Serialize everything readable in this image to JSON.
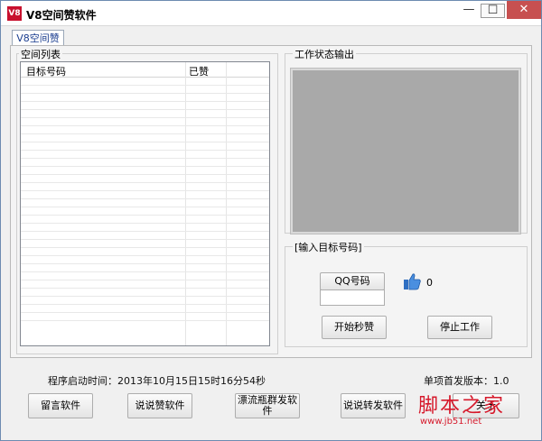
{
  "window": {
    "title": "V8空间赞软件",
    "icon_text": "V8"
  },
  "titlebar": {
    "minimize": "—",
    "maximize": "☐",
    "close": "✕"
  },
  "tab": {
    "label": "V8空间赞"
  },
  "space_list": {
    "group_label": "空间列表",
    "columns": [
      "目标号码",
      "已赞"
    ]
  },
  "status": {
    "group_label": "工作状态输出"
  },
  "target": {
    "group_label": "[输入目标号码]",
    "qq_label": "QQ号码",
    "qq_value": "",
    "like_count": "0",
    "start_button": "开始秒赞",
    "stop_button": "停止工作"
  },
  "footer": {
    "start_time": "程序启动时间：2013年10月15日15时16分54秒",
    "version": "单项首发版本：1.0",
    "buttons": [
      "留言软件",
      "说说赞软件",
      "漂流瓶群发软件",
      "说说转发软件",
      "关于"
    ]
  },
  "watermark": {
    "main": "脚本之家",
    "sub": "www.jb51.net"
  },
  "colors": {
    "title_close": "#c75050",
    "tab_text": "#1a3d8f",
    "watermark": "#d6192b",
    "status_bg": "#a9a9a9"
  }
}
